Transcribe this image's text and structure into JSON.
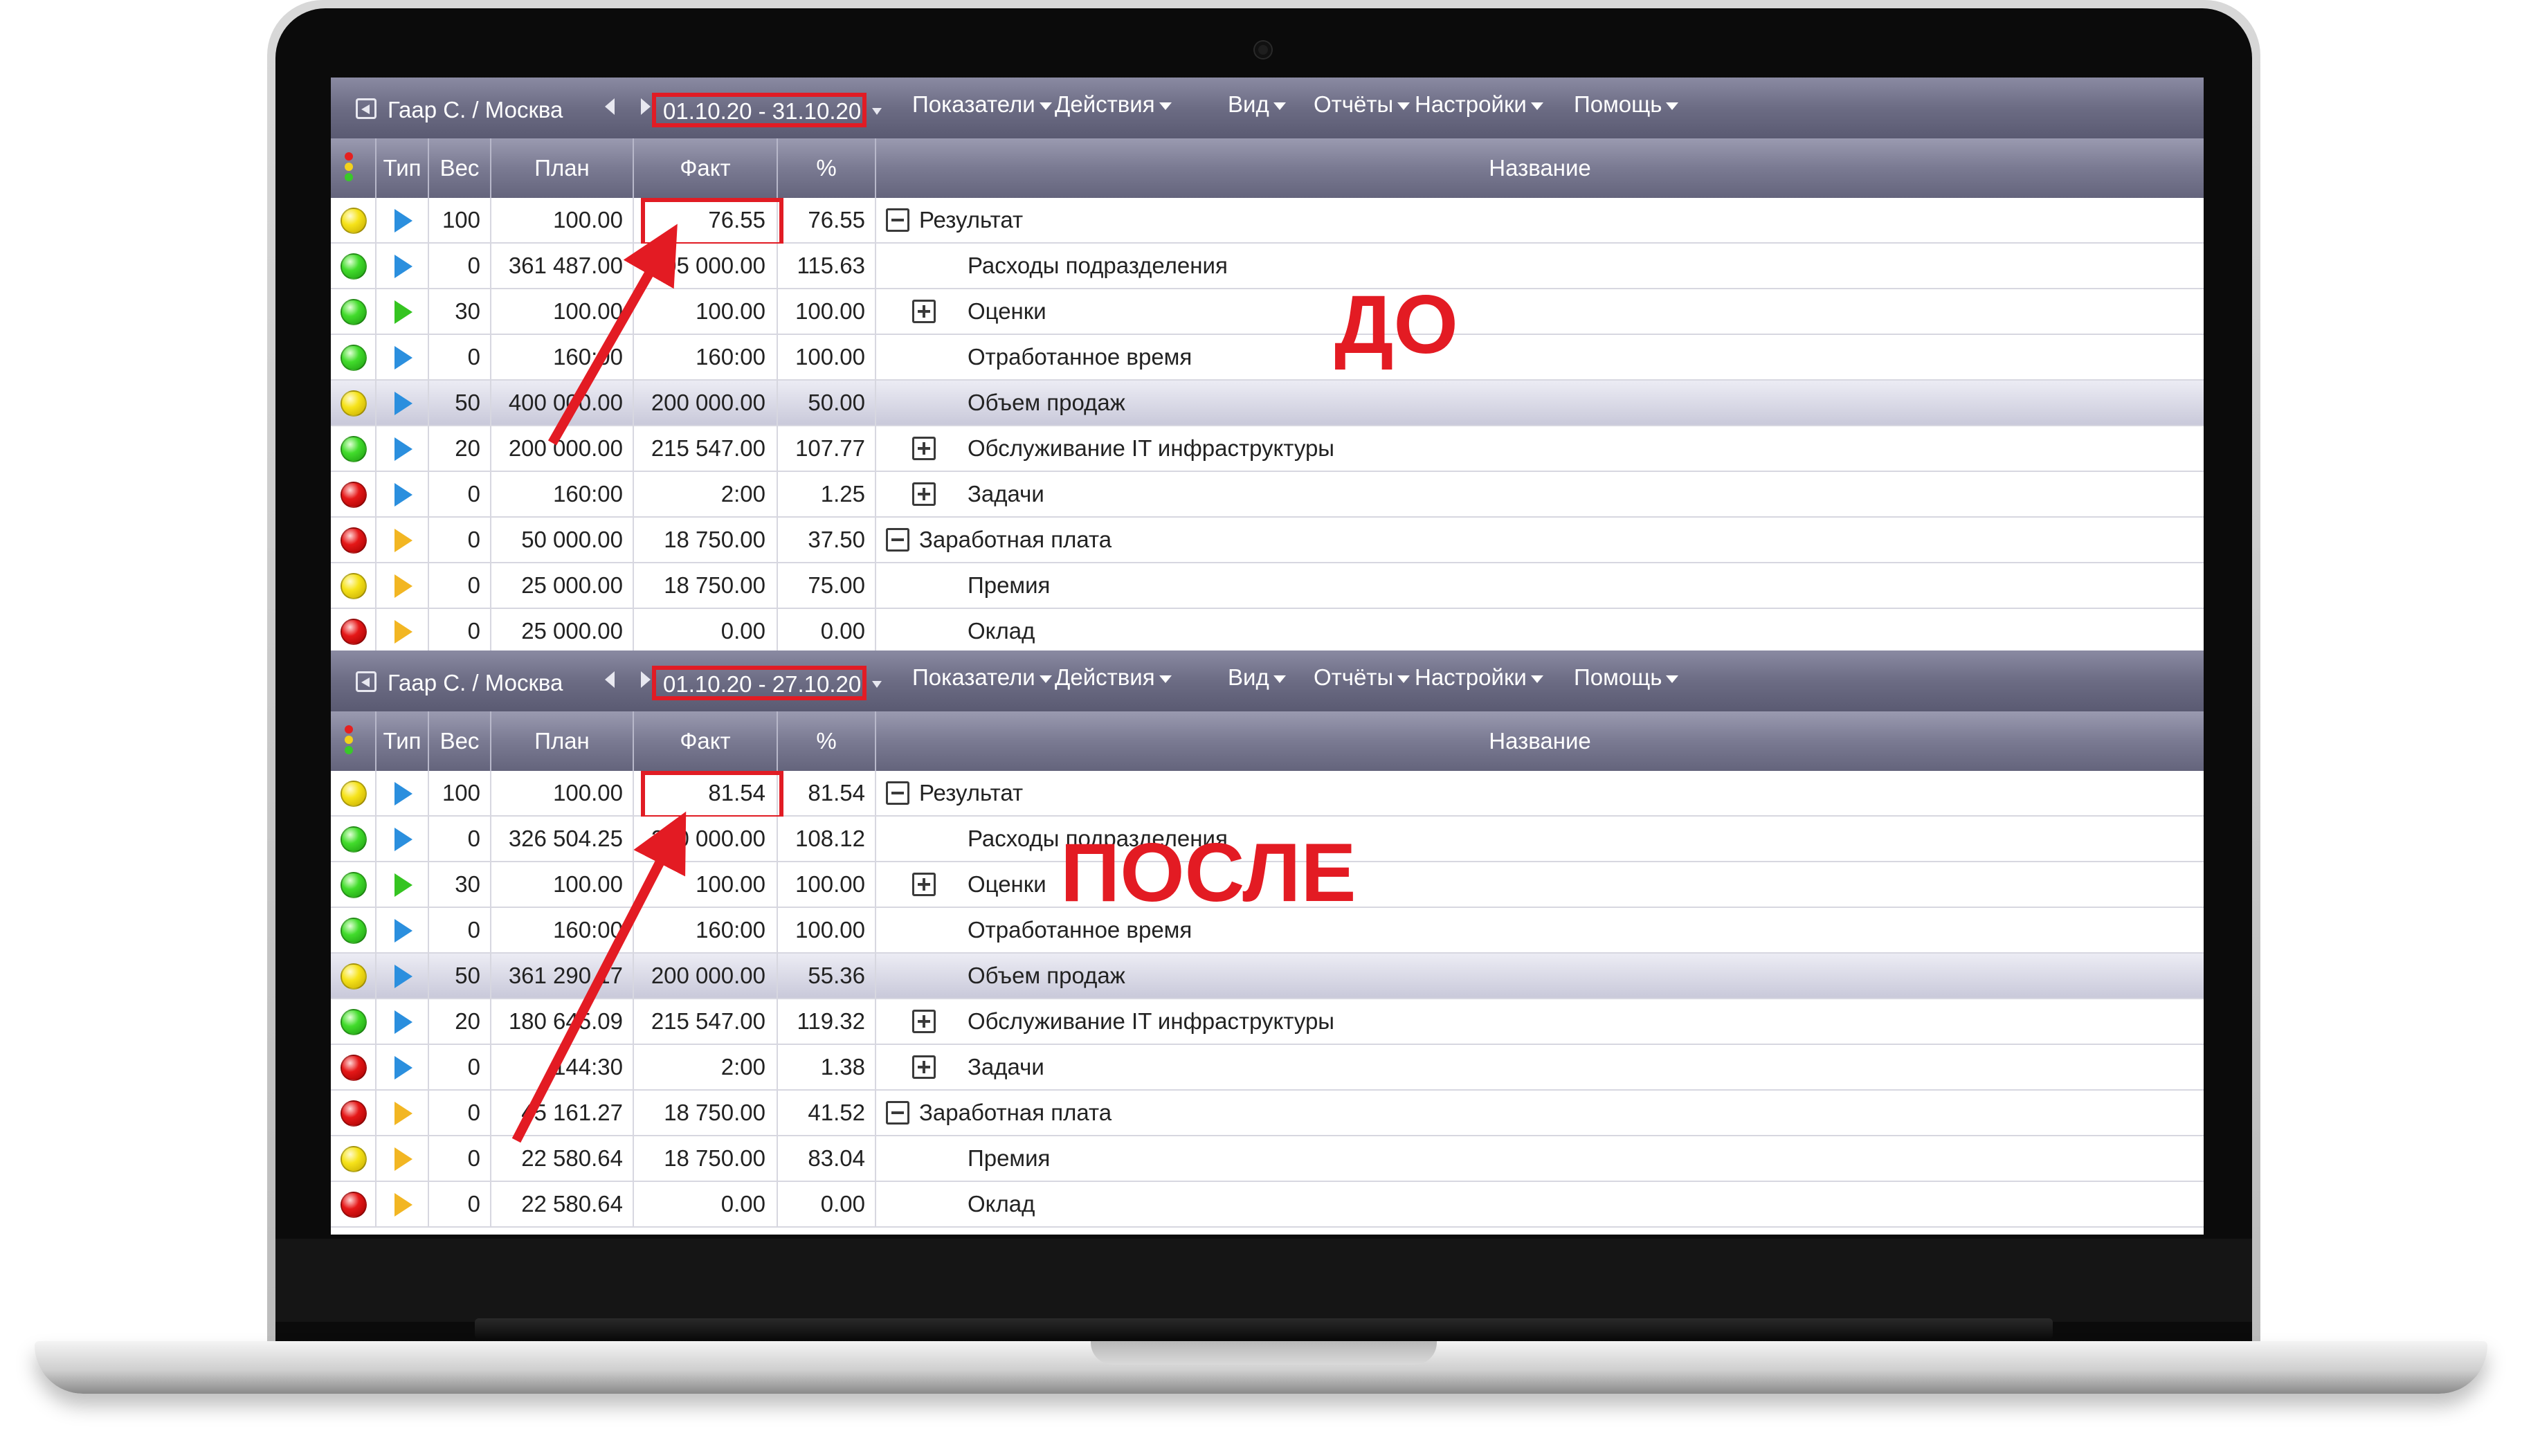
{
  "toolbar": {
    "user": "Гаар С. / Москва",
    "menus": [
      "Показатели",
      "Действия",
      "Вид",
      "Отчёты",
      "Настройки",
      "Помощь"
    ]
  },
  "columns": {
    "type": "Тип",
    "weight": "Вес",
    "plan": "План",
    "fact": "Факт",
    "percent": "%",
    "name": "Название"
  },
  "panels": [
    {
      "label": "ДО",
      "period": "01.10.20 - 31.10.20",
      "rows": [
        {
          "status": "yellow",
          "kind": "blue",
          "weight": "100",
          "plan": "100.00",
          "fact": "76.55",
          "percent": "76.55",
          "toggle": "minus",
          "indent": 0,
          "name": "Результат"
        },
        {
          "status": "green",
          "kind": "blue",
          "weight": "0",
          "plan": "361 487.00",
          "fact": "305 000.00",
          "percent": "115.63",
          "toggle": "",
          "indent": 1,
          "name": "Расходы подразделения"
        },
        {
          "status": "green",
          "kind": "green",
          "weight": "30",
          "plan": "100.00",
          "fact": "100.00",
          "percent": "100.00",
          "toggle": "plus",
          "indent": 1,
          "name": "Оценки"
        },
        {
          "status": "green",
          "kind": "blue",
          "weight": "0",
          "plan": "160:00",
          "fact": "160:00",
          "percent": "100.00",
          "toggle": "",
          "indent": 1,
          "name": "Отработанное время"
        },
        {
          "status": "yellow",
          "kind": "blue",
          "weight": "50",
          "plan": "400 000.00",
          "fact": "200 000.00",
          "percent": "50.00",
          "toggle": "",
          "indent": 1,
          "name": "Объем продаж",
          "highlight": true
        },
        {
          "status": "green",
          "kind": "blue",
          "weight": "20",
          "plan": "200 000.00",
          "fact": "215 547.00",
          "percent": "107.77",
          "toggle": "plus",
          "indent": 1,
          "name": "Обслуживание IT инфраструктуры"
        },
        {
          "status": "red",
          "kind": "blue",
          "weight": "0",
          "plan": "160:00",
          "fact": "2:00",
          "percent": "1.25",
          "toggle": "plus",
          "indent": 1,
          "name": "Задачи"
        },
        {
          "status": "red",
          "kind": "orange",
          "weight": "0",
          "plan": "50 000.00",
          "fact": "18 750.00",
          "percent": "37.50",
          "toggle": "minus",
          "indent": 0,
          "name": "Заработная плата"
        },
        {
          "status": "yellow",
          "kind": "orange",
          "weight": "0",
          "plan": "25 000.00",
          "fact": "18 750.00",
          "percent": "75.00",
          "toggle": "",
          "indent": 1,
          "name": "Премия"
        },
        {
          "status": "red",
          "kind": "orange",
          "weight": "0",
          "plan": "25 000.00",
          "fact": "0.00",
          "percent": "0.00",
          "toggle": "",
          "indent": 1,
          "name": "Оклад"
        }
      ]
    },
    {
      "label": "ПОСЛЕ",
      "period": "01.10.20 - 27.10.20",
      "rows": [
        {
          "status": "yellow",
          "kind": "blue",
          "weight": "100",
          "plan": "100.00",
          "fact": "81.54",
          "percent": "81.54",
          "toggle": "minus",
          "indent": 0,
          "name": "Результат"
        },
        {
          "status": "green",
          "kind": "blue",
          "weight": "0",
          "plan": "326 504.25",
          "fact": "200 000.00",
          "percent": "108.12",
          "toggle": "",
          "indent": 1,
          "name": "Расходы подразделения"
        },
        {
          "status": "green",
          "kind": "green",
          "weight": "30",
          "plan": "100.00",
          "fact": "100.00",
          "percent": "100.00",
          "toggle": "plus",
          "indent": 1,
          "name": "Оценки"
        },
        {
          "status": "green",
          "kind": "blue",
          "weight": "0",
          "plan": "160:00",
          "fact": "160:00",
          "percent": "100.00",
          "toggle": "",
          "indent": 1,
          "name": "Отработанное время"
        },
        {
          "status": "yellow",
          "kind": "blue",
          "weight": "50",
          "plan": "361 290.17",
          "fact": "200 000.00",
          "percent": "55.36",
          "toggle": "",
          "indent": 1,
          "name": "Объем продаж",
          "highlight": true
        },
        {
          "status": "green",
          "kind": "blue",
          "weight": "20",
          "plan": "180 645.09",
          "fact": "215 547.00",
          "percent": "119.32",
          "toggle": "plus",
          "indent": 1,
          "name": "Обслуживание IT инфраструктуры"
        },
        {
          "status": "red",
          "kind": "blue",
          "weight": "0",
          "plan": "144:30",
          "fact": "2:00",
          "percent": "1.38",
          "toggle": "plus",
          "indent": 1,
          "name": "Задачи"
        },
        {
          "status": "red",
          "kind": "orange",
          "weight": "0",
          "plan": "45 161.27",
          "fact": "18 750.00",
          "percent": "41.52",
          "toggle": "minus",
          "indent": 0,
          "name": "Заработная плата"
        },
        {
          "status": "yellow",
          "kind": "orange",
          "weight": "0",
          "plan": "22 580.64",
          "fact": "18 750.00",
          "percent": "83.04",
          "toggle": "",
          "indent": 1,
          "name": "Премия"
        },
        {
          "status": "red",
          "kind": "orange",
          "weight": "0",
          "plan": "22 580.64",
          "fact": "0.00",
          "percent": "0.00",
          "toggle": "",
          "indent": 1,
          "name": "Оклад"
        }
      ]
    }
  ],
  "colors": {
    "annotation": "#e31b23",
    "toolbar": "#6c6c84"
  }
}
